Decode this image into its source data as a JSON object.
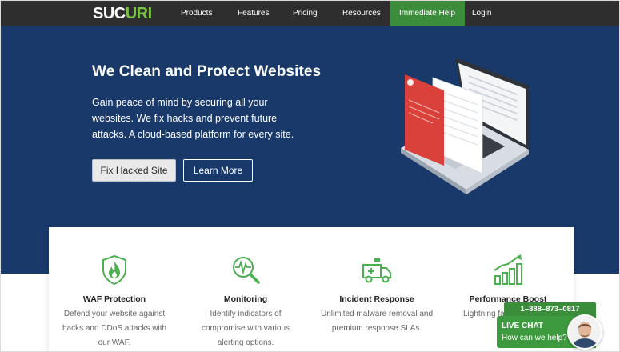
{
  "nav": {
    "logo": {
      "text_white": "SUC",
      "text_green": "URI"
    },
    "items": [
      {
        "label": "Products"
      },
      {
        "label": "Features"
      },
      {
        "label": "Pricing"
      },
      {
        "label": "Resources"
      }
    ],
    "help_label": "Immediate Help",
    "login_label": "Login"
  },
  "hero": {
    "title": "We Clean and Protect Websites",
    "body": "Gain peace of mind by securing all your websites. We fix hacks and prevent future attacks. A cloud-based platform for every site.",
    "primary_button": "Fix Hacked Site",
    "secondary_button": "Learn More"
  },
  "features": [
    {
      "icon": "shield-flame-icon",
      "title": "WAF Protection",
      "desc": "Defend your website against hacks and DDoS attacks with our WAF."
    },
    {
      "icon": "magnifier-pulse-icon",
      "title": "Monitoring",
      "desc": "Identify indicators of compromise with various alerting options."
    },
    {
      "icon": "ambulance-icon",
      "title": "Incident Response",
      "desc": "Unlimited malware removal and premium response SLAs."
    },
    {
      "icon": "growth-chart-icon",
      "title": "Performance Boost",
      "desc": "Lightning fa with our h"
    }
  ],
  "chat": {
    "phone": "1–888–873–0817",
    "title": "LIVE CHAT",
    "subtitle": "How can we help?"
  },
  "colors": {
    "nav_bg": "#2e2e2e",
    "hero_bg": "#19396a",
    "brand_green": "#3b8d3b",
    "icon_green": "#4caf50"
  }
}
